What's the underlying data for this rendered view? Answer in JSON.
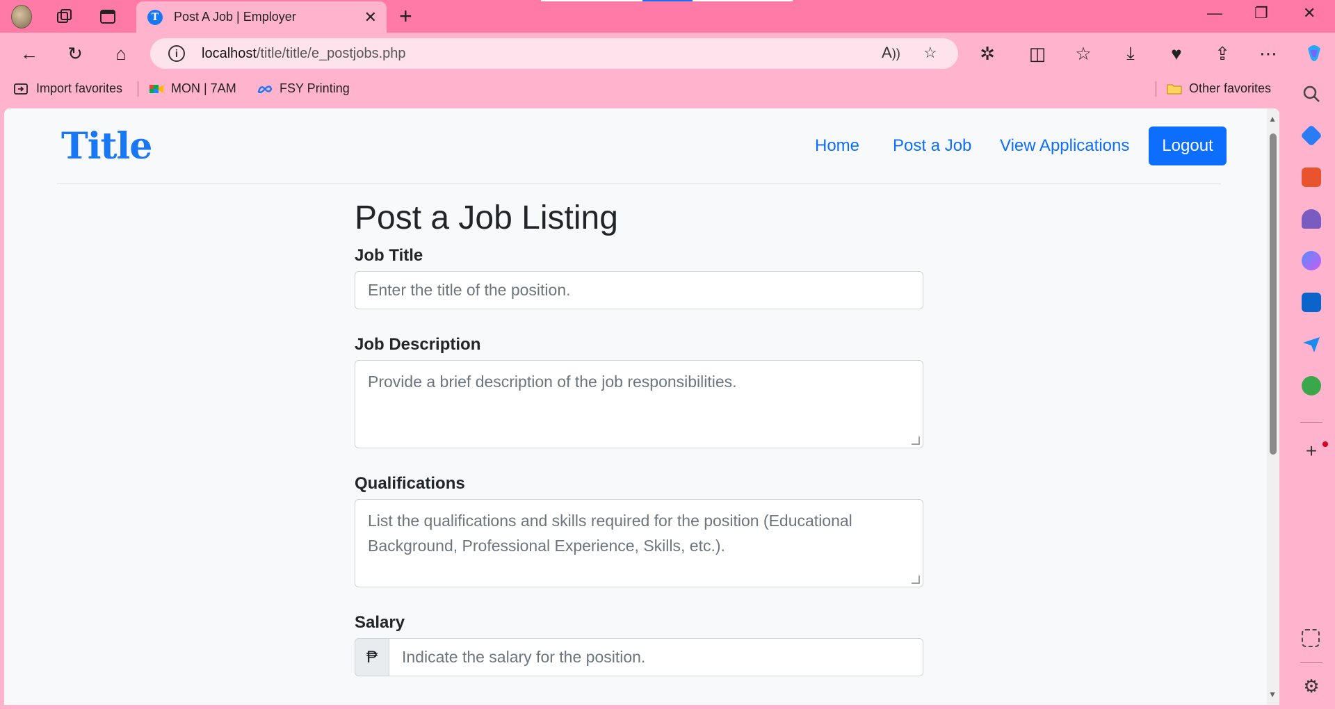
{
  "browser": {
    "tab_title": "Post A Job | Employer",
    "url_host": "localhost",
    "url_path": "/title/title/e_postjobs.php",
    "bookmarks": [
      {
        "label": "Import favorites",
        "icon": "import-icon"
      },
      {
        "label": "MON | 7AM",
        "icon": "meet-icon"
      },
      {
        "label": "FSY Printing",
        "icon": "meta-icon"
      }
    ],
    "other_favorites": "Other favorites"
  },
  "site": {
    "brand": "Title",
    "nav": {
      "home": "Home",
      "post_job": "Post a Job",
      "view_applications": "View Applications",
      "logout": "Logout"
    }
  },
  "form": {
    "title": "Post a Job Listing",
    "job_title": {
      "label": "Job Title",
      "placeholder": "Enter the title of the position."
    },
    "job_description": {
      "label": "Job Description",
      "placeholder": "Provide a brief description of the job responsibilities."
    },
    "qualifications": {
      "label": "Qualifications",
      "placeholder": "List the qualifications and skills required for the position (Educational Background, Professional Experience, Skills, etc.)."
    },
    "salary": {
      "label": "Salary",
      "currency": "₱",
      "placeholder": "Indicate the salary for the position."
    }
  },
  "colors": {
    "primary": "#0d6efd",
    "chrome": "#ff7aa6",
    "chrome_light": "#ffb3cc"
  }
}
